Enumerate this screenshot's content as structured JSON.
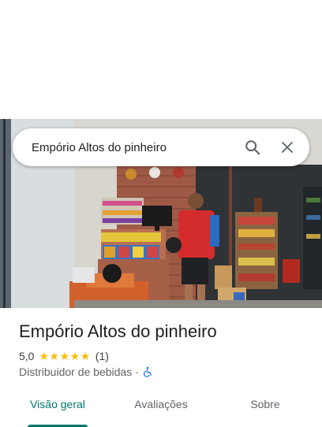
{
  "search": {
    "query": "Empório Altos do pinheiro"
  },
  "place": {
    "name": "Empório Altos do pinheiro",
    "rating": "5,0",
    "stars": 5,
    "review_count": "(1)",
    "category": "Distribuidor de bebidas",
    "separator": "·"
  },
  "tabs": [
    {
      "label": "Visão geral",
      "active": true
    },
    {
      "label": "Avaliações",
      "active": false
    },
    {
      "label": "Sobre",
      "active": false
    }
  ],
  "colors": {
    "accent": "#00796b",
    "star": "#fbbc04",
    "accessible_icon": "#1a73e8"
  },
  "icons": [
    "search-icon",
    "close-icon",
    "star-icon",
    "wheelchair-icon"
  ]
}
